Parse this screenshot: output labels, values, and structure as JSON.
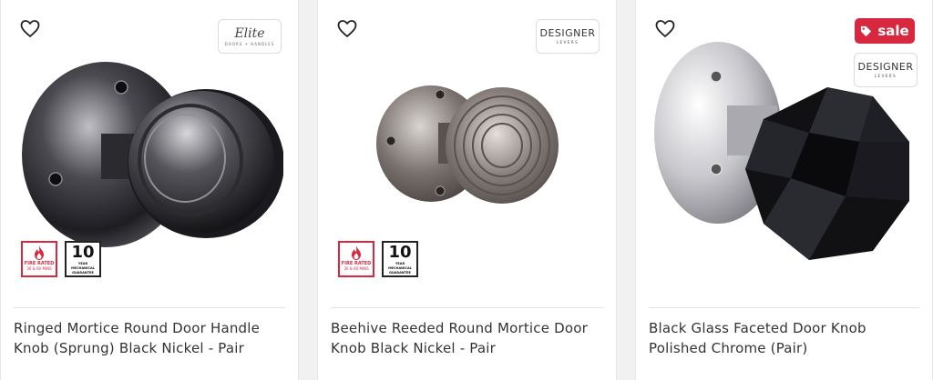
{
  "products": [
    {
      "title": "Ringed Mortice Round Door Handle Knob (Sprung) Black Nickel - Pair",
      "brand": {
        "main": "Elite",
        "sub": "DOORS + HANDLES"
      },
      "badges": {
        "fire_line1": "FIRE RATED",
        "fire_line2": "30 & 60 MINS",
        "mech_number": "10",
        "mech_years": "YEAR",
        "mech_line1": "MECHANICAL",
        "mech_line2": "GUARANTEE"
      }
    },
    {
      "title": "Beehive Reeded Round Mortice Door Knob Black Nickel - Pair",
      "brand": {
        "main": "DESIGNER",
        "sub": "LEVERS"
      },
      "badges": {
        "fire_line1": "FIRE RATED",
        "fire_line2": "30 & 60 MINS",
        "mech_number": "10",
        "mech_years": "YEAR",
        "mech_line1": "MECHANICAL",
        "mech_line2": "GUARANTEE"
      }
    },
    {
      "title": "Black Glass Faceted Door Knob Polished Chrome (Pair)",
      "brand": {
        "main": "DESIGNER",
        "sub": "LEVERS"
      },
      "sale_label": "sale"
    }
  ],
  "colors": {
    "sale": "#d8283f",
    "fire": "#d8283f",
    "text": "#333333"
  },
  "icons": [
    "heart-icon",
    "tag-icon",
    "flame-icon"
  ]
}
